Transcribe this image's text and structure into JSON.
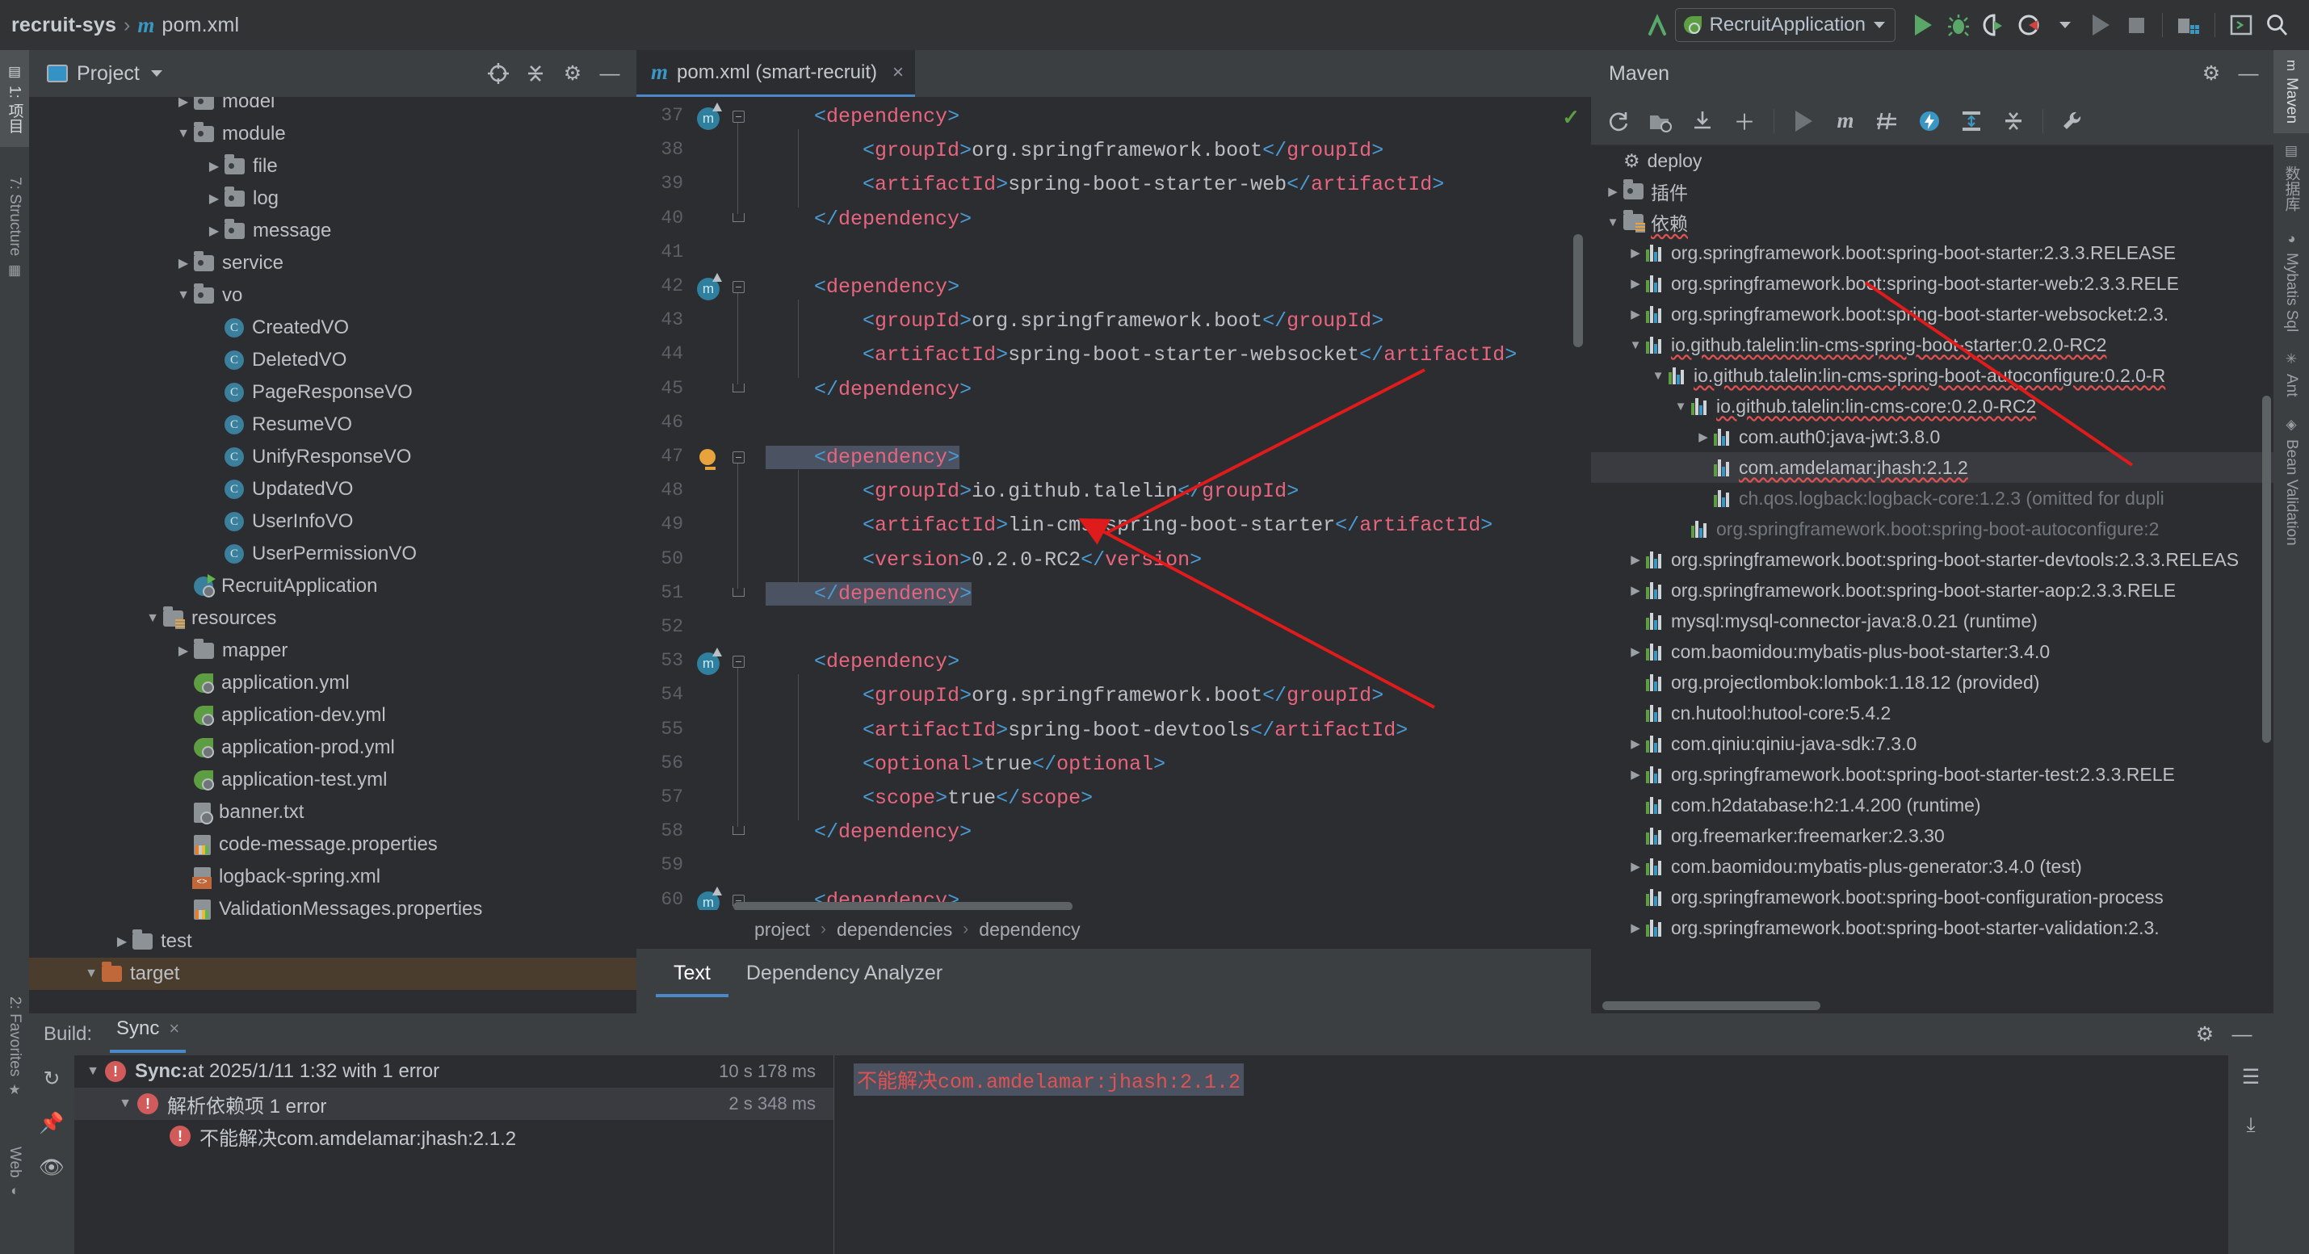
{
  "window": {
    "breadcrumb": {
      "project": "recruit-sys",
      "separator": "›",
      "file": "pom.xml",
      "icon": "maven-m-icon"
    },
    "run_config": {
      "label": "RecruitApplication",
      "icon": "spring-boot-icon"
    },
    "toolbar_icons": [
      "update-project-icon",
      "run-icon",
      "debug-icon",
      "run-coverage-icon",
      "profiler-icon",
      "run-dropdown-icon",
      "run-disabled-icon",
      "stop-icon",
      "project-structure-icon",
      "terminal-icon",
      "search-everywhere-icon"
    ]
  },
  "left_rail": [
    {
      "label": "1: 项目",
      "icon": "project-icon",
      "selected": true
    },
    {
      "label": "7: Structure",
      "icon": "structure-icon",
      "selected": false
    },
    {
      "label": "2: Favorites",
      "icon": "favorites-star-icon",
      "selected": false
    },
    {
      "label": "Web",
      "icon": "web-icon",
      "selected": false
    }
  ],
  "project_panel": {
    "title": "Project",
    "tools": [
      "locate-icon",
      "collapse-all-icon",
      "settings-gear-icon",
      "hide-icon"
    ],
    "tree": [
      {
        "label": "model",
        "indent": 4,
        "arrow": "right",
        "icon": "folder-package",
        "partial": true
      },
      {
        "label": "module",
        "indent": 4,
        "arrow": "down",
        "icon": "folder-package"
      },
      {
        "label": "file",
        "indent": 5,
        "arrow": "right",
        "icon": "folder-package"
      },
      {
        "label": "log",
        "indent": 5,
        "arrow": "right",
        "icon": "folder-package"
      },
      {
        "label": "message",
        "indent": 5,
        "arrow": "right",
        "icon": "folder-package"
      },
      {
        "label": "service",
        "indent": 4,
        "arrow": "right",
        "icon": "folder-package"
      },
      {
        "label": "vo",
        "indent": 4,
        "arrow": "down",
        "icon": "folder-package"
      },
      {
        "label": "CreatedVO",
        "indent": 5,
        "arrow": "none",
        "icon": "java-class"
      },
      {
        "label": "DeletedVO",
        "indent": 5,
        "arrow": "none",
        "icon": "java-class"
      },
      {
        "label": "PageResponseVO",
        "indent": 5,
        "arrow": "none",
        "icon": "java-class"
      },
      {
        "label": "ResumeVO",
        "indent": 5,
        "arrow": "none",
        "icon": "java-class"
      },
      {
        "label": "UnifyResponseVO",
        "indent": 5,
        "arrow": "none",
        "icon": "java-class"
      },
      {
        "label": "UpdatedVO",
        "indent": 5,
        "arrow": "none",
        "icon": "java-class"
      },
      {
        "label": "UserInfoVO",
        "indent": 5,
        "arrow": "none",
        "icon": "java-class"
      },
      {
        "label": "UserPermissionVO",
        "indent": 5,
        "arrow": "none",
        "icon": "java-class"
      },
      {
        "label": "RecruitApplication",
        "indent": 4,
        "arrow": "none",
        "icon": "spring-boot-class"
      },
      {
        "label": "resources",
        "indent": 3,
        "arrow": "down",
        "icon": "folder-resources"
      },
      {
        "label": "mapper",
        "indent": 4,
        "arrow": "right",
        "icon": "folder-plain"
      },
      {
        "label": "application.yml",
        "indent": 4,
        "arrow": "none",
        "icon": "spring-yaml"
      },
      {
        "label": "application-dev.yml",
        "indent": 4,
        "arrow": "none",
        "icon": "spring-yaml"
      },
      {
        "label": "application-prod.yml",
        "indent": 4,
        "arrow": "none",
        "icon": "spring-yaml"
      },
      {
        "label": "application-test.yml",
        "indent": 4,
        "arrow": "none",
        "icon": "spring-yaml"
      },
      {
        "label": "banner.txt",
        "indent": 4,
        "arrow": "none",
        "icon": "text-file-spring"
      },
      {
        "label": "code-message.properties",
        "indent": 4,
        "arrow": "none",
        "icon": "properties-file"
      },
      {
        "label": "logback-spring.xml",
        "indent": 4,
        "arrow": "none",
        "icon": "xml-file"
      },
      {
        "label": "ValidationMessages.properties",
        "indent": 4,
        "arrow": "none",
        "icon": "properties-file"
      },
      {
        "label": "test",
        "indent": 2,
        "arrow": "right",
        "icon": "folder-plain"
      },
      {
        "label": "target",
        "indent": 1,
        "arrow": "down",
        "icon": "folder-orange",
        "highlighted": true
      }
    ]
  },
  "editor": {
    "tab": {
      "label": "pom.xml (smart-recruit)",
      "icon": "maven-m-icon",
      "close": "×"
    },
    "breadcrumb": [
      "project",
      "dependencies",
      "dependency"
    ],
    "bottom_tabs": [
      {
        "label": "Text",
        "selected": true
      },
      {
        "label": "Dependency Analyzer",
        "selected": false
      }
    ],
    "lines": [
      {
        "n": 37,
        "text": "    <dependency>",
        "mark": "run-gutter",
        "fold": "start"
      },
      {
        "n": 38,
        "text": "        <groupId>org.springframework.boot</groupId>"
      },
      {
        "n": 39,
        "text": "        <artifactId>spring-boot-starter-web</artifactId>"
      },
      {
        "n": 40,
        "text": "    </dependency>",
        "fold": "end"
      },
      {
        "n": 41,
        "text": ""
      },
      {
        "n": 42,
        "text": "    <dependency>",
        "mark": "run-gutter",
        "fold": "start"
      },
      {
        "n": 43,
        "text": "        <groupId>org.springframework.boot</groupId>"
      },
      {
        "n": 44,
        "text": "        <artifactId>spring-boot-starter-websocket</artifactId>"
      },
      {
        "n": 45,
        "text": "    </dependency>",
        "fold": "end"
      },
      {
        "n": 46,
        "text": ""
      },
      {
        "n": 47,
        "text": "    <dependency>",
        "mark": "bulb",
        "fold": "start",
        "highlight": true
      },
      {
        "n": 48,
        "text": "        <groupId>io.github.talelin</groupId>"
      },
      {
        "n": 49,
        "text": "        <artifactId>lin-cms-spring-boot-starter</artifactId>"
      },
      {
        "n": 50,
        "text": "        <version>0.2.0-RC2</version>"
      },
      {
        "n": 51,
        "text": "    </dependency>",
        "fold": "end",
        "highlight": true
      },
      {
        "n": 52,
        "text": ""
      },
      {
        "n": 53,
        "text": "    <dependency>",
        "mark": "run-gutter",
        "fold": "start"
      },
      {
        "n": 54,
        "text": "        <groupId>org.springframework.boot</groupId>"
      },
      {
        "n": 55,
        "text": "        <artifactId>spring-boot-devtools</artifactId>"
      },
      {
        "n": 56,
        "text": "        <optional>true</optional>"
      },
      {
        "n": 57,
        "text": "        <scope>true</scope>"
      },
      {
        "n": 58,
        "text": "    </dependency>",
        "fold": "end"
      },
      {
        "n": 59,
        "text": ""
      },
      {
        "n": 60,
        "text": "    <dependency>",
        "mark": "run-gutter",
        "fold": "start"
      }
    ]
  },
  "maven_panel": {
    "title": "Maven",
    "head_tools": [
      "settings-gear-icon",
      "hide-icon"
    ],
    "toolbar_icons": [
      "reload-icon",
      "add-maven-projects-icon",
      "download-sources-icon",
      "plus-icon",
      "run-icon",
      "maven-m-icon",
      "skip-tests-icon",
      "execute-goal-icon",
      "expand-icon",
      "collapse-icon",
      "settings-wrench-icon"
    ],
    "tree": [
      {
        "label": "deploy",
        "indent": 1,
        "arrow": "none",
        "icon": "phase-gear"
      },
      {
        "label": "插件",
        "indent": 1,
        "arrow": "right",
        "icon": "folder-plugins"
      },
      {
        "label": "依赖",
        "indent": 1,
        "arrow": "down",
        "icon": "folder-dependencies",
        "wavy": true
      },
      {
        "label": "org.springframework.boot:spring-boot-starter:2.3.3.RELEASE",
        "indent": 2,
        "arrow": "right",
        "icon": "dependency-bars"
      },
      {
        "label": "org.springframework.boot:spring-boot-starter-web:2.3.3.RELE",
        "indent": 2,
        "arrow": "right",
        "icon": "dependency-bars"
      },
      {
        "label": "org.springframework.boot:spring-boot-starter-websocket:2.3.",
        "indent": 2,
        "arrow": "right",
        "icon": "dependency-bars"
      },
      {
        "label": "io.github.talelin:lin-cms-spring-boot-starter:0.2.0-RC2",
        "indent": 2,
        "arrow": "down",
        "icon": "dependency-bars",
        "wavy": true
      },
      {
        "label": "io.github.talelin:lin-cms-spring-boot-autoconfigure:0.2.0-R",
        "indent": 3,
        "arrow": "down",
        "icon": "dependency-bars",
        "wavy": true
      },
      {
        "label": "io.github.talelin:lin-cms-core:0.2.0-RC2",
        "indent": 4,
        "arrow": "down",
        "icon": "dependency-bars",
        "wavy": true
      },
      {
        "label": "com.auth0:java-jwt:3.8.0",
        "indent": 5,
        "arrow": "right",
        "icon": "dependency-bars"
      },
      {
        "label": "com.amdelamar:jhash:2.1.2",
        "indent": 5,
        "arrow": "none",
        "icon": "dependency-bars",
        "wavy": true,
        "selected": true
      },
      {
        "label": "ch.qos.logback:logback-core:1.2.3 (omitted for dupli",
        "indent": 5,
        "arrow": "none",
        "icon": "dependency-bars",
        "dim": true
      },
      {
        "label": "org.springframework.boot:spring-boot-autoconfigure:2",
        "indent": 4,
        "arrow": "none",
        "icon": "dependency-bars",
        "dim": true
      },
      {
        "label": "org.springframework.boot:spring-boot-starter-devtools:2.3.3.RELEAS",
        "indent": 2,
        "arrow": "right",
        "icon": "dependency-bars"
      },
      {
        "label": "org.springframework.boot:spring-boot-starter-aop:2.3.3.RELE",
        "indent": 2,
        "arrow": "right",
        "icon": "dependency-bars"
      },
      {
        "label": "mysql:mysql-connector-java:8.0.21 (runtime)",
        "indent": 2,
        "arrow": "none",
        "icon": "dependency-bars",
        "suffix_dim": " (runtime)"
      },
      {
        "label": "com.baomidou:mybatis-plus-boot-starter:3.4.0",
        "indent": 2,
        "arrow": "right",
        "icon": "dependency-bars"
      },
      {
        "label": "org.projectlombok:lombok:1.18.12 (provided)",
        "indent": 2,
        "arrow": "none",
        "icon": "dependency-bars"
      },
      {
        "label": "cn.hutool:hutool-core:5.4.2",
        "indent": 2,
        "arrow": "none",
        "icon": "dependency-bars"
      },
      {
        "label": "com.qiniu:qiniu-java-sdk:7.3.0",
        "indent": 2,
        "arrow": "right",
        "icon": "dependency-bars"
      },
      {
        "label": "org.springframework.boot:spring-boot-starter-test:2.3.3.RELE",
        "indent": 2,
        "arrow": "right",
        "icon": "dependency-bars"
      },
      {
        "label": "com.h2database:h2:1.4.200 (runtime)",
        "indent": 2,
        "arrow": "none",
        "icon": "dependency-bars"
      },
      {
        "label": "org.freemarker:freemarker:2.3.30",
        "indent": 2,
        "arrow": "none",
        "icon": "dependency-bars"
      },
      {
        "label": "com.baomidou:mybatis-plus-generator:3.4.0 (test)",
        "indent": 2,
        "arrow": "right",
        "icon": "dependency-bars"
      },
      {
        "label": "org.springframework.boot:spring-boot-configuration-process",
        "indent": 2,
        "arrow": "none",
        "icon": "dependency-bars"
      },
      {
        "label": "org.springframework.boot:spring-boot-starter-validation:2.3.",
        "indent": 2,
        "arrow": "right",
        "icon": "dependency-bars"
      }
    ]
  },
  "right_rail": [
    {
      "label": "Maven",
      "icon": "maven-m-icon",
      "selected": true
    },
    {
      "label": "数据库",
      "icon": "database-icon",
      "selected": false
    },
    {
      "label": "Mybatis Sql",
      "icon": "mybatis-icon",
      "selected": false
    },
    {
      "label": "Ant",
      "icon": "ant-icon",
      "selected": false
    },
    {
      "label": "Bean Validation",
      "icon": "bean-validation-icon",
      "selected": false
    }
  ],
  "build_panel": {
    "label": "Build:",
    "tab": {
      "label": "Sync",
      "close": "×"
    },
    "tools": [
      "settings-gear-icon",
      "hide-icon"
    ],
    "rail_icons": [
      "rerun-icon",
      "pin-icon",
      "eye-icon"
    ],
    "right_icons": [
      "wrap-text-icon",
      "scroll-to-end-icon"
    ],
    "rows": [
      {
        "arrow": "down",
        "indent": 0,
        "bold": "Sync:",
        "text": " at 2025/1/11 1:32 with 1 error",
        "time": "10 s 178 ms",
        "error": true
      },
      {
        "arrow": "down",
        "indent": 1,
        "bold": "",
        "text": "解析依赖项  1 error",
        "time": "2 s 348 ms",
        "error": true,
        "selected": true
      },
      {
        "arrow": "none",
        "indent": 2,
        "bold": "",
        "text": "不能解决com.amdelamar:jhash:2.1.2",
        "time": "",
        "error": true
      }
    ],
    "detail_text": "不能解决com.amdelamar:jhash:2.1.2"
  },
  "colors": {
    "accent_blue": "#4a88c7",
    "error_red": "#e05252",
    "tag_pink": "#e8657f",
    "bracket_blue": "#4a9ad4",
    "text_default": "#bcbec4",
    "panel_bg": "#3c3f41",
    "editor_bg": "#2b2d30",
    "highlight_bg": "#4b5261",
    "target_folder_bg": "#4b3d2e",
    "annotation_arrow": "#e01b1b"
  }
}
